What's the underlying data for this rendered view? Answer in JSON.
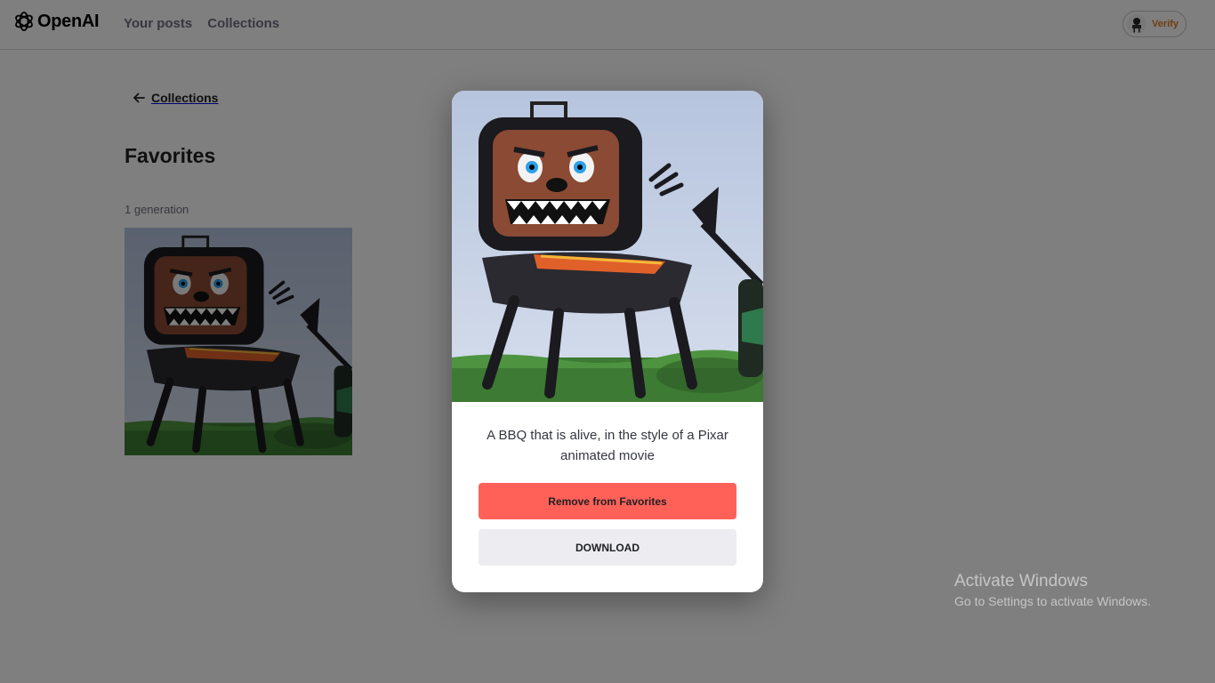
{
  "header": {
    "logo_text": "OpenAI",
    "nav": [
      "Your posts",
      "Collections"
    ],
    "verify_label": "Verify"
  },
  "page": {
    "back_label": "Collections",
    "title": "Favorites",
    "generation_count": "1 generation"
  },
  "modal": {
    "caption": "A BBQ that is alive, in the style of a Pixar animated movie",
    "remove_label": "Remove from Favorites",
    "download_label": "DOWNLOAD"
  },
  "watermark": {
    "title": "Activate Windows",
    "subtitle": "Go to Settings to activate Windows."
  },
  "colors": {
    "remove_button": "#ff6159",
    "download_button": "#ececf1",
    "verify_text": "#e07b23",
    "overlay": "rgba(0,0,0,0.5)"
  },
  "icons": [
    "openai-logo-icon",
    "arrow-left-icon",
    "user-avatar-icon"
  ]
}
